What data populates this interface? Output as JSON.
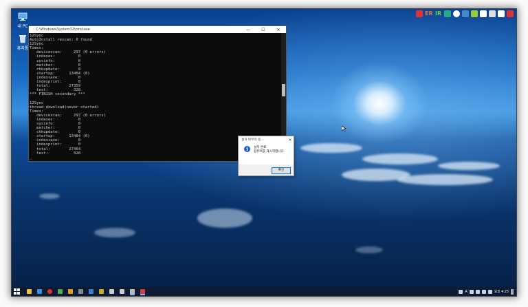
{
  "desktop": {
    "icons": [
      {
        "label": "내 PC",
        "icon": "computer-icon"
      },
      {
        "label": "휴지통",
        "icon": "recycle-bin-icon"
      }
    ],
    "tray_top": {
      "colors": [
        "#d33",
        "#6b3",
        "#2a8",
        "#3cc",
        "#fff",
        "#48c",
        "#9c3",
        "#fff",
        "#fff",
        "#ddd",
        "#fff",
        "#d33"
      ],
      "labels": [
        "ER",
        "IR"
      ]
    }
  },
  "console": {
    "title": "C:\\Windows\\System32\\cmd.exe",
    "minimize": "—",
    "maximize": "☐",
    "close": "✕",
    "lines": [
      "12Sync",
      "AutoInstall rescan: 0 found",
      "12Sync",
      "Times:",
      "   devicescan:     297 (0 errors)",
      "   indexes:          0",
      "   sysinfo:          0",
      "   matcher:          0",
      "   chkupdate:        0",
      "   startup:      13484 (0)",
      "   indexsave:        0",
      "   indexprint:       0",
      "   total:        27359",
      "   test:           328",
      "*** FINISH secondary ***",
      "",
      "12Sync",
      "thread_download(never started)",
      "Times:",
      "   devicescan:     297 (0 errors)",
      "   indexes:          0",
      "   sysinfo:          0",
      "   matcher:          0",
      "   chkupdate:        0",
      "   startup:      13484 (0)",
      "   indexsave:        0",
      "   indexprint:       0",
      "   total:        27464",
      "   test:           328",
      "_"
    ]
  },
  "dialog": {
    "title": "설치 마무리 중...",
    "close": "✕",
    "message_line1": "설치 완료",
    "message_line2": "컴퓨터를 재시작합니다.",
    "ok_label": "확인",
    "icon": "info-icon"
  },
  "taskbar": {
    "apps": [
      {
        "name": "explorer",
        "color": "#f0c040"
      },
      {
        "name": "edge",
        "color": "#3a8fe0"
      },
      {
        "name": "opera",
        "color": "#e0302a"
      },
      {
        "name": "app4",
        "color": "#55aa55"
      },
      {
        "name": "app5",
        "color": "#e0a020"
      },
      {
        "name": "app6",
        "color": "#888888"
      },
      {
        "name": "app7",
        "color": "#3a7fd0"
      },
      {
        "name": "app8",
        "color": "#ccaa22"
      },
      {
        "name": "app9",
        "color": "#cccccc"
      },
      {
        "name": "app10",
        "color": "#cccccc"
      },
      {
        "name": "cmd",
        "color": "#bbbbbb"
      },
      {
        "name": "installer",
        "color": "#d04040"
      }
    ],
    "clock": "오후 4:25"
  }
}
